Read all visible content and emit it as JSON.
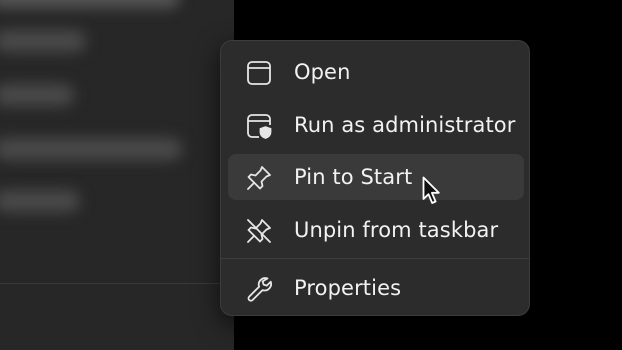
{
  "background": {
    "panel_color": "#272727",
    "desktop_color": "#000000"
  },
  "context_menu": {
    "items": [
      {
        "label": "Open",
        "icon": "window-icon",
        "hovered": false
      },
      {
        "label": "Run as administrator",
        "icon": "admin-shield-icon",
        "hovered": false
      },
      {
        "label": "Pin to Start",
        "icon": "pin-icon",
        "hovered": true
      },
      {
        "label": "Unpin from taskbar",
        "icon": "unpin-icon",
        "hovered": false
      },
      {
        "label": "Properties",
        "icon": "wrench-icon",
        "hovered": false
      }
    ],
    "colors": {
      "menu_bg": "#2c2c2c",
      "hover_bg": "#3a3a3a",
      "text": "#f2f2f2"
    }
  },
  "cursor": {
    "icon": "mouse-pointer-icon"
  }
}
